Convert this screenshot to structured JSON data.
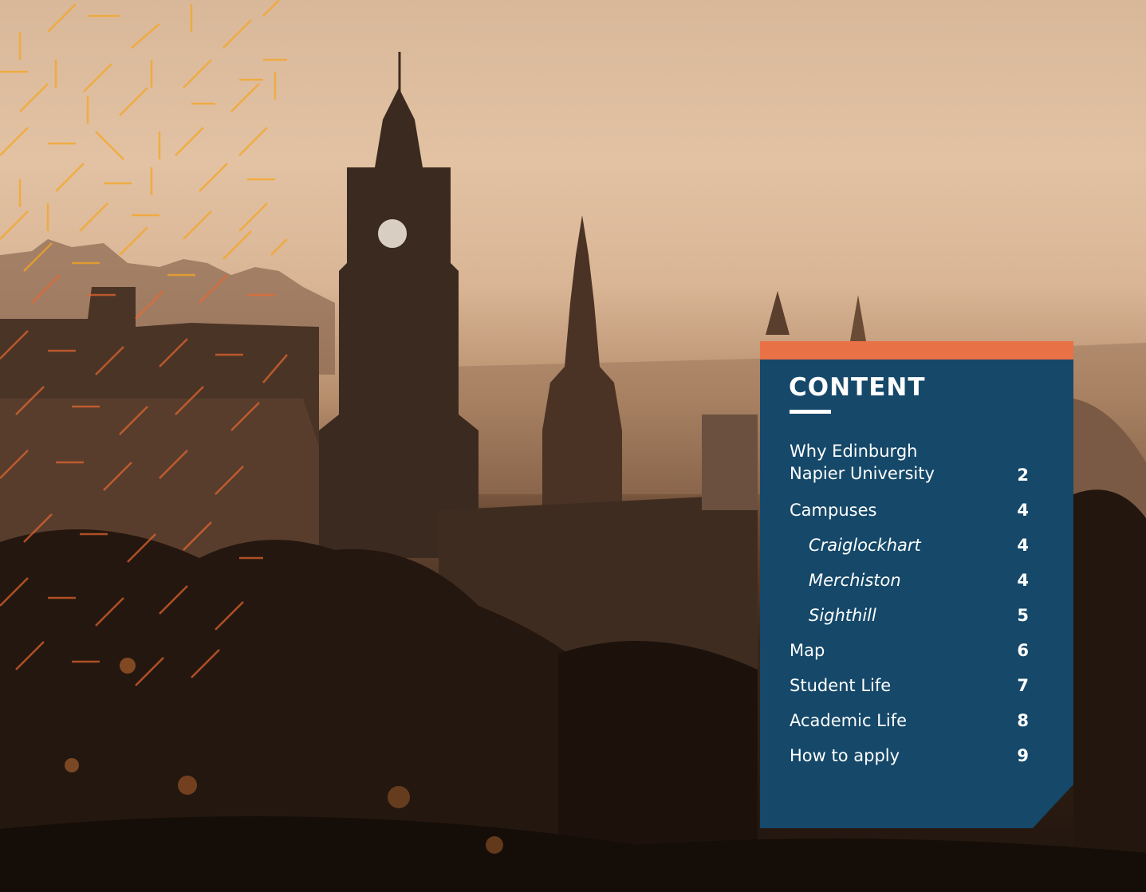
{
  "contents": {
    "title": "CONTENT",
    "items": [
      {
        "label_line1": "Why Edinburgh",
        "label_line2": "Napier University",
        "page": "2"
      },
      {
        "label": "Campuses",
        "page": "4"
      },
      {
        "label": "Craiglockhart",
        "page": "4"
      },
      {
        "label": "Merchiston",
        "page": "4"
      },
      {
        "label": "Sighthill",
        "page": "5"
      },
      {
        "label": "Map",
        "page": "6"
      },
      {
        "label": "Student Life",
        "page": "7"
      },
      {
        "label": "Academic Life",
        "page": "8"
      },
      {
        "label": "How to apply",
        "page": "9"
      }
    ]
  },
  "colors": {
    "panel": "#154869",
    "accent": "#e97146",
    "pattern": "#f5a623"
  }
}
